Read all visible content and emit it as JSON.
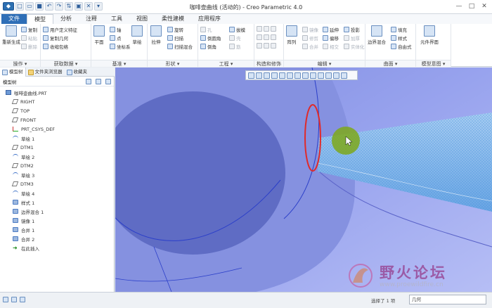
{
  "window": {
    "title": "咖啡壶曲线 (活动的) - Creo Parametric 4.0"
  },
  "quick_access": [
    "new-icon",
    "open-icon",
    "save-icon",
    "undo-icon",
    "redo-icon",
    "regenerate-icon",
    "window-icon",
    "close-icon",
    "customize-icon"
  ],
  "tabs": [
    "文件",
    "模型",
    "分析",
    "注释",
    "工具",
    "视图",
    "柔性建模",
    "应用程序"
  ],
  "active_tab": "模型",
  "ribbon": {
    "operations": {
      "label": "操作 ▾",
      "regen": "重新生成",
      "copy": "复制",
      "paste": "粘贴",
      "delete": "删除"
    },
    "get_data": {
      "label": "获取数据 ▾",
      "udf": "用户定义特征",
      "copy_geom": "复制几何",
      "shrinkwrap": "收缩包络"
    },
    "datum": {
      "label": "基准 ▾",
      "plane": "平面",
      "axis": "轴",
      "point": "点",
      "csys": "坐标系",
      "sketch": "草绘"
    },
    "shapes": {
      "label": "形状 ▾",
      "extrude": "拉伸",
      "revolve": "旋转",
      "sweep": "扫描",
      "swept_blend": "扫描混合"
    },
    "engineering": {
      "label": "工程 ▾",
      "hole": "孔",
      "round": "倒圆角",
      "chamfer": "倒角",
      "draft": "拔模",
      "shell": "壳",
      "rib": "筋"
    },
    "constructs": {
      "label": "构造和修饰"
    },
    "editing": {
      "label": "编辑 ▾",
      "pattern": "阵列",
      "mirror": "镜像",
      "extend": "延伸",
      "trim": "修剪",
      "merge": "合并",
      "intersect": "相交",
      "project": "投影",
      "offset": "偏移",
      "thicken": "加厚",
      "solidify": "实体化"
    },
    "surfaces": {
      "label": "曲面 ▾",
      "boundary_blend": "边界混合",
      "fill": "填充",
      "style": "样式",
      "freestyle": "自由式"
    },
    "model_intent": {
      "label": "模型意图 ▾",
      "component_interface": "元件界面"
    }
  },
  "panel_tabs": [
    "模型树",
    "文件夹浏览器",
    "收藏夹"
  ],
  "panel": {
    "title": "模型树",
    "root": "咖啡壶曲线.PRT",
    "items": [
      {
        "label": "RIGHT",
        "icon": "plane"
      },
      {
        "label": "TOP",
        "icon": "plane"
      },
      {
        "label": "FRONT",
        "icon": "plane"
      },
      {
        "label": "PRT_CSYS_DEF",
        "icon": "csys"
      },
      {
        "label": "草绘 1",
        "icon": "curve"
      },
      {
        "label": "DTM1",
        "icon": "plane"
      },
      {
        "label": "草绘 2",
        "icon": "curve"
      },
      {
        "label": "DTM2",
        "icon": "plane"
      },
      {
        "label": "草绘 3",
        "icon": "curve"
      },
      {
        "label": "DTM3",
        "icon": "plane"
      },
      {
        "label": "草绘 4",
        "icon": "curve"
      },
      {
        "label": "样式 1",
        "icon": "feat"
      },
      {
        "label": "边界混合 1",
        "icon": "feat"
      },
      {
        "label": "镜像 1",
        "icon": "feat"
      },
      {
        "label": "合并 1",
        "icon": "feat"
      },
      {
        "label": "合并 2",
        "icon": "feat"
      },
      {
        "label": "在此插入",
        "icon": "insert"
      }
    ]
  },
  "status": {
    "selection": "选择了 1 项",
    "filter": "几何"
  },
  "watermark": {
    "text": "野火论坛",
    "url": "www.proewildfire.cn"
  },
  "colors": {
    "accent": "#2f6fb7",
    "model_surface": "#8f9be8",
    "highlight_curve": "#e02a2a",
    "selection": "#4fb7ea"
  }
}
